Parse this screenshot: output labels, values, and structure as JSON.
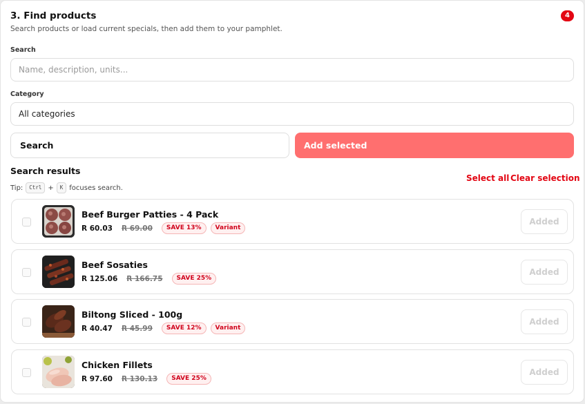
{
  "section": {
    "title": "3. Find products",
    "badge": "4",
    "subtitle": "Search products or load current specials, then add them to your pamphlet."
  },
  "search": {
    "label": "Search",
    "placeholder": "Name, description, units...",
    "value": ""
  },
  "category": {
    "label": "Category",
    "selected": "All categories"
  },
  "actions": {
    "search_label": "Search",
    "add_selected_label": "Add selected"
  },
  "results": {
    "heading": "Search results",
    "tip_prefix": "Tip:",
    "tip_key1": "Ctrl",
    "tip_plus": "+",
    "tip_key2": "K",
    "tip_suffix": "focuses search.",
    "select_all_label": "Select all",
    "clear_selection_label": "Clear selection",
    "items": [
      {
        "name": "Beef Burger Patties - 4 Pack",
        "price": "R 60.03",
        "old_price": "R 69.00",
        "save": "SAVE 13%",
        "variant": "Variant",
        "button": "Added",
        "image_icon": "burger-patties-icon"
      },
      {
        "name": "Beef Sosaties",
        "price": "R 125.06",
        "old_price": "R 166.75",
        "save": "SAVE 25%",
        "variant": "",
        "button": "Added",
        "image_icon": "sosaties-icon"
      },
      {
        "name": "Biltong Sliced - 100g",
        "price": "R 40.47",
        "old_price": "R 45.99",
        "save": "SAVE 12%",
        "variant": "Variant",
        "button": "Added",
        "image_icon": "biltong-icon"
      },
      {
        "name": "Chicken Fillets",
        "price": "R 97.60",
        "old_price": "R 130.13",
        "save": "SAVE 25%",
        "variant": "",
        "button": "Added",
        "image_icon": "chicken-fillets-icon"
      }
    ]
  },
  "colors": {
    "accent": "#e30613",
    "add_button": "#ff6f6f"
  }
}
